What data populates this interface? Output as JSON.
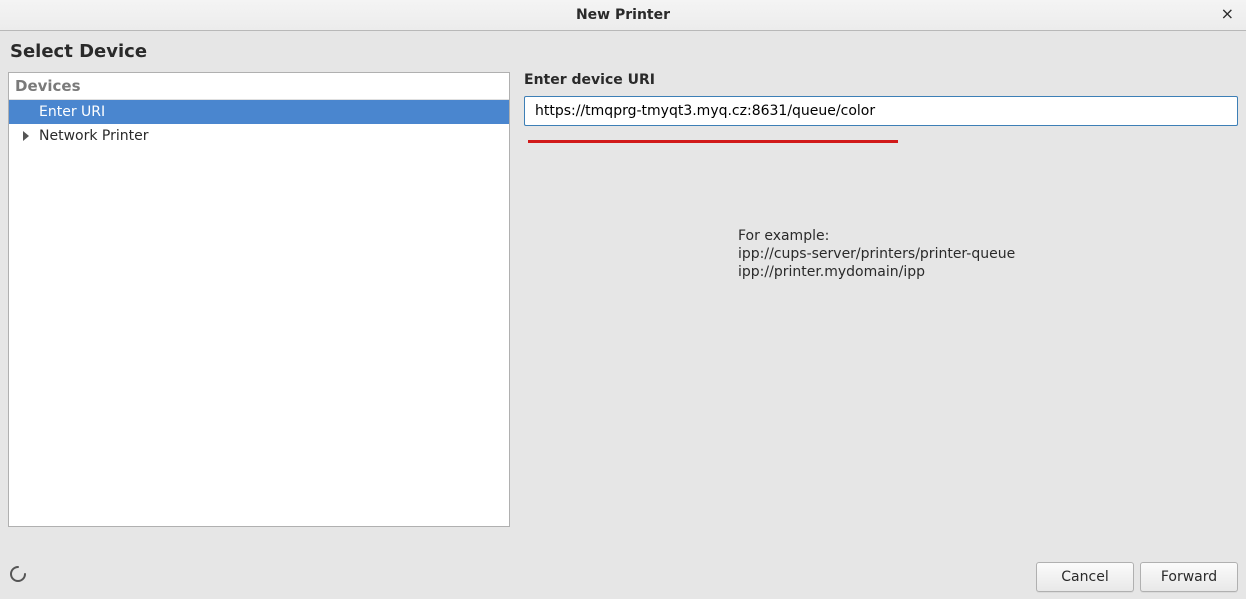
{
  "window": {
    "title": "New Printer"
  },
  "section": {
    "title": "Select Device"
  },
  "devices": {
    "header": "Devices",
    "items": [
      {
        "label": "Enter URI",
        "selected": true,
        "expandable": false
      },
      {
        "label": "Network Printer",
        "selected": false,
        "expandable": true
      }
    ]
  },
  "uri": {
    "label": "Enter device URI",
    "value": "https://tmqprg-tmyqt3.myq.cz:8631/queue/color",
    "example": "For example:\nipp://cups-server/printers/printer-queue\nipp://printer.mydomain/ipp"
  },
  "buttons": {
    "cancel": "Cancel",
    "forward": "Forward"
  }
}
